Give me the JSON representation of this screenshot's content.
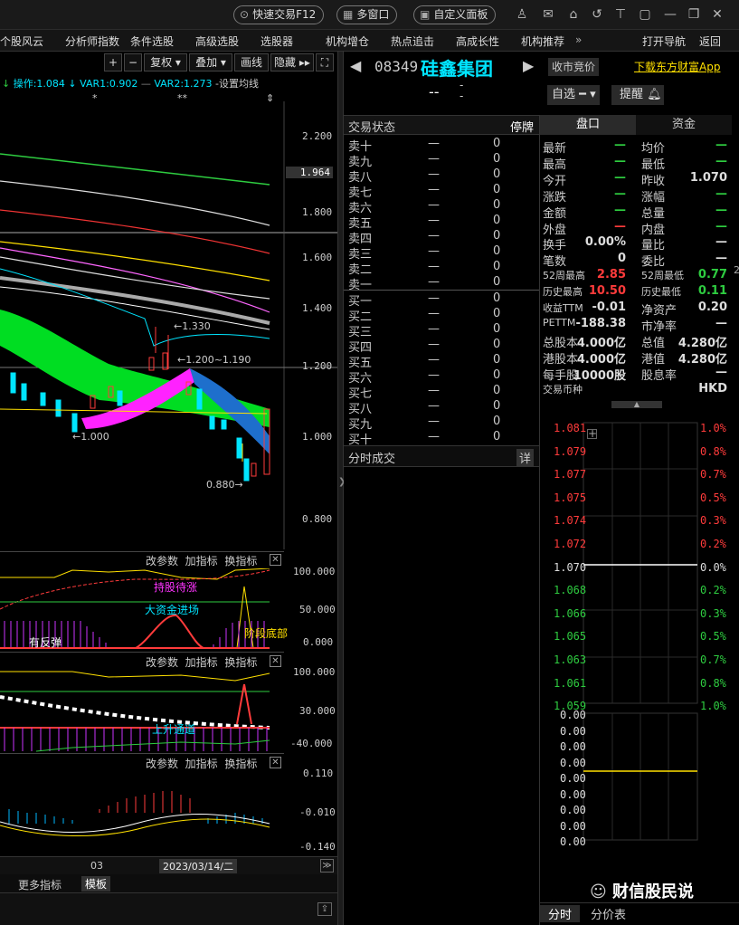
{
  "topbar": {
    "quick_trade": "快速交易F12",
    "multi_window": "多窗口",
    "custom_panel": "自定义面板"
  },
  "menu": {
    "items": [
      "个股风云",
      "分析师指数",
      "条件选股",
      "高级选股",
      "选股器",
      "机构增仓",
      "热点追击",
      "高成长性",
      "机构推荐"
    ],
    "more": "»",
    "open_nav": "打开导航",
    "back": "返回"
  },
  "chart_toolbar": {
    "fuquan": "复权",
    "diejia": "叠加",
    "huaxian": "画线",
    "yincang": "隐藏"
  },
  "indicator_bar": {
    "op": "操作:1.084",
    "var1": "VAR1:0.902",
    "var2": "VAR2:1.273",
    "set_ma": "-设置均线"
  },
  "price_axis": [
    "2.200",
    "1.964",
    "1.800",
    "1.600",
    "1.400",
    "1.200",
    "1.000",
    "0.800"
  ],
  "chart_labels": {
    "l1330": "1.330",
    "l1200": "1.200~1.190",
    "l1000": "1.000",
    "l0880": "0.880",
    "stars1": "*",
    "stars2": "**"
  },
  "panel_controls": {
    "a": "改参数",
    "b": "加指标",
    "c": "换指标"
  },
  "ind1": {
    "axis": [
      "100.000",
      "50.000",
      "0.000"
    ],
    "t1": "持股待涨",
    "t2": "大资金进场",
    "t3": "有反弹",
    "t4": "阶段底部"
  },
  "ind2": {
    "axis": [
      "100.000",
      "30.000",
      "-40.000"
    ],
    "t1": "上升通道"
  },
  "ind3": {
    "axis": [
      "0.110",
      "-0.010",
      "-0.140"
    ]
  },
  "date_axis": {
    "month": "03",
    "cursor": "2023/03/14/二"
  },
  "bottom_tabs": {
    "more": "更多指标",
    "template": "模板"
  },
  "stock": {
    "code": "08349",
    "name": "硅鑫集团",
    "status_btn": "收市竞价",
    "download": "下载东方财富App",
    "price": "--",
    "change": "-",
    "zixuan": "自选",
    "tixing": "提醒"
  },
  "orderbook": {
    "title": "交易状态",
    "status": "停牌",
    "sells": [
      {
        "label": "卖十",
        "p": "—",
        "v": "0"
      },
      {
        "label": "卖九",
        "p": "—",
        "v": "0"
      },
      {
        "label": "卖八",
        "p": "—",
        "v": "0"
      },
      {
        "label": "卖七",
        "p": "—",
        "v": "0"
      },
      {
        "label": "卖六",
        "p": "—",
        "v": "0"
      },
      {
        "label": "卖五",
        "p": "—",
        "v": "0"
      },
      {
        "label": "卖四",
        "p": "—",
        "v": "0"
      },
      {
        "label": "卖三",
        "p": "—",
        "v": "0"
      },
      {
        "label": "卖二",
        "p": "—",
        "v": "0"
      },
      {
        "label": "卖一",
        "p": "—",
        "v": "0"
      }
    ],
    "buys": [
      {
        "label": "买一",
        "p": "—",
        "v": "0"
      },
      {
        "label": "买二",
        "p": "—",
        "v": "0"
      },
      {
        "label": "买三",
        "p": "—",
        "v": "0"
      },
      {
        "label": "买四",
        "p": "—",
        "v": "0"
      },
      {
        "label": "买五",
        "p": "—",
        "v": "0"
      },
      {
        "label": "买六",
        "p": "—",
        "v": "0"
      },
      {
        "label": "买七",
        "p": "—",
        "v": "0"
      },
      {
        "label": "买八",
        "p": "—",
        "v": "0"
      },
      {
        "label": "买九",
        "p": "—",
        "v": "0"
      },
      {
        "label": "买十",
        "p": "—",
        "v": "0"
      }
    ],
    "fenshi": "分时成交",
    "detail": "详"
  },
  "quote_tabs": {
    "pankou": "盘口",
    "zijin": "资金"
  },
  "quote": [
    [
      {
        "k": "最新",
        "v": "—",
        "c": "green"
      },
      {
        "k": "均价",
        "v": "—",
        "c": "green"
      }
    ],
    [
      {
        "k": "最高",
        "v": "—",
        "c": "green"
      },
      {
        "k": "最低",
        "v": "—",
        "c": "green"
      }
    ],
    [
      {
        "k": "今开",
        "v": "—",
        "c": "green"
      },
      {
        "k": "昨收",
        "v": "1.070",
        "c": "white"
      }
    ],
    [
      {
        "k": "涨跌",
        "v": "—",
        "c": "green"
      },
      {
        "k": "涨幅",
        "v": "—",
        "c": "green"
      }
    ],
    [
      {
        "k": "金额",
        "v": "—",
        "c": "green"
      },
      {
        "k": "总量",
        "v": "—",
        "c": "green"
      }
    ],
    [
      {
        "k": "外盘",
        "v": "—",
        "c": "red"
      },
      {
        "k": "内盘",
        "v": "—",
        "c": "green"
      }
    ],
    [
      {
        "k": "换手",
        "v": "0.00%",
        "c": "white"
      },
      {
        "k": "量比",
        "v": "—",
        "c": "white"
      }
    ],
    [
      {
        "k": "笔数",
        "v": "0",
        "c": "white"
      },
      {
        "k": "委比",
        "v": "—",
        "c": "white"
      }
    ],
    [
      {
        "k": "52周最高",
        "v": "2.85",
        "c": "red"
      },
      {
        "k": "52周最低",
        "v": "0.77",
        "c": "green"
      }
    ],
    [
      {
        "k": "历史最高",
        "v": "10.50",
        "c": "red"
      },
      {
        "k": "历史最低",
        "v": "0.11",
        "c": "green"
      }
    ],
    [
      {
        "k": "收益TTM",
        "v": "-0.01",
        "c": "white"
      },
      {
        "k": "净资产",
        "v": "0.20",
        "c": "white"
      }
    ],
    [
      {
        "k": "PETTM",
        "v": "-188.38",
        "c": "white"
      },
      {
        "k": "市净率",
        "v": "—",
        "c": "white"
      }
    ],
    [
      {
        "k": "总股本",
        "v": "4.000亿",
        "c": "white"
      },
      {
        "k": "总值",
        "v": "4.280亿",
        "c": "white"
      }
    ],
    [
      {
        "k": "港股本",
        "v": "4.000亿",
        "c": "white"
      },
      {
        "k": "港值",
        "v": "4.280亿",
        "c": "white"
      }
    ],
    [
      {
        "k": "每手股",
        "v": "10000股",
        "c": "white"
      },
      {
        "k": "股息率",
        "v": "—",
        "c": "white"
      }
    ],
    [
      {
        "k": "交易币种",
        "v": "",
        "c": "white"
      },
      {
        "k": "",
        "v": "HKD",
        "c": "white"
      }
    ]
  ],
  "minute_axis_left": [
    "1.081",
    "1.079",
    "1.077",
    "1.075",
    "1.074",
    "1.072",
    "1.070",
    "1.068",
    "1.066",
    "1.065",
    "1.063",
    "1.061",
    "1.059"
  ],
  "minute_axis_right": [
    "1.0%",
    "0.8%",
    "0.7%",
    "0.5%",
    "0.3%",
    "0.2%",
    "0.0%",
    "0.2%",
    "0.3%",
    "0.5%",
    "0.7%",
    "0.8%",
    "1.0%"
  ],
  "vol_axis": [
    "0.00",
    "0.00",
    "0.00",
    "0.00",
    "0.00",
    "0.00",
    "0.00",
    "0.00",
    "0.00"
  ],
  "right_bottom_tabs": {
    "fenshi": "分时",
    "fenjia": "分价表"
  },
  "watermark": "财信股民说",
  "edge_mark": "2",
  "colors": {
    "up": "#ff3b3b",
    "down": "#2ecc40",
    "cyan": "#00e5ff",
    "yellow": "#ffe000",
    "magenta": "#ff00ff"
  }
}
